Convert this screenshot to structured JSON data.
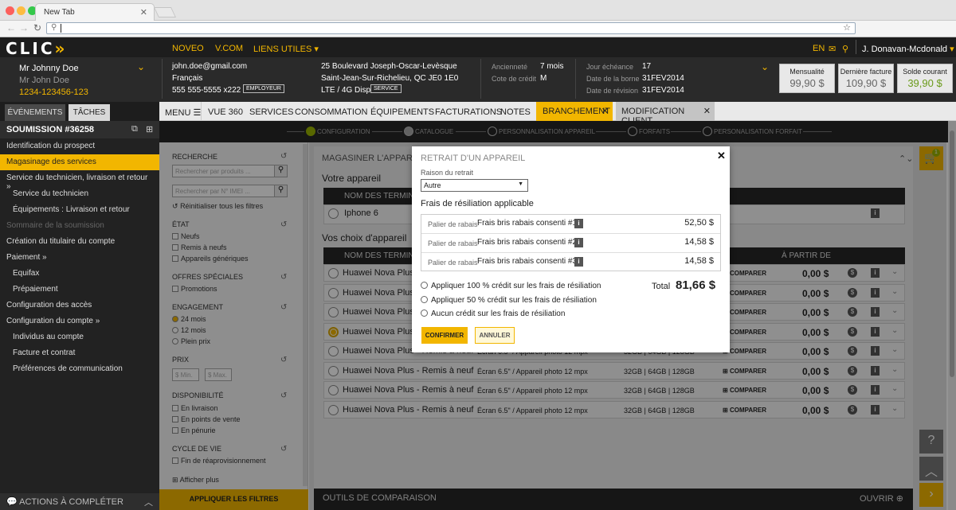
{
  "browser": {
    "tab_title": "New Tab"
  },
  "app": {
    "logo": "CLIC",
    "nav": [
      "NOVEO",
      "V.COM",
      "LIENS UTILES"
    ],
    "lang": "EN",
    "user": "J. Donavan-Mcdonald"
  },
  "customer": {
    "name": "Mr Johnny Doe",
    "name2": "Mr John Doe",
    "account": "1234-123456-123",
    "email": "john.doe@gmail.com",
    "language": "Français",
    "phone": "555 555-5555 x222",
    "phone_badge": "EMPLOYEUR",
    "address1": "25 Boulevard Joseph-Oscar-Levèsque",
    "address2": "Saint-Jean-Sur-Richelieu, QC JE0 1E0",
    "network": "LTE / 4G Disp",
    "network_badge": "SERVICE",
    "seniority_label": "Ancienneté",
    "seniority_value": "7 mois",
    "credit_label": "Cote de crédit",
    "credit_value": "M",
    "due_label": "Jour échéance",
    "due_value": "17",
    "kiosk_label": "Date de la borne",
    "kiosk_value": "31FEV2014",
    "revision_label": "Date de révision",
    "revision_value": "31FEV2014",
    "kpis": [
      {
        "label": "Mensualité",
        "value": "99,90 $"
      },
      {
        "label": "Dernière facture",
        "value": "109,90 $"
      },
      {
        "label": "Solde courant",
        "value": "39,90 $"
      }
    ]
  },
  "left_tabs": {
    "events": "ÉVÉNEMENTS",
    "tasks": "TÂCHES"
  },
  "menu": {
    "menu_label": "MENU",
    "items": [
      "VUE 360",
      "SERVICES",
      "CONSOMMATION",
      "ÉQUIPEMENTS",
      "FACTURATIONS",
      "NOTES"
    ],
    "active_tab": "BRANCHEMENT",
    "modify_tab": "MODIFICATION CLIENT"
  },
  "sidebar": {
    "submission": "SOUMISSION #36258",
    "items": [
      "Identification du prospect",
      "Magasinage des services",
      "Service du technicien, livraison et retour",
      "Service du technicien",
      "Équipements : Livraison et retour",
      "Sommaire de la soumission",
      "Création du titulaire du compte",
      "Paiement",
      "Equifax",
      "Prépaiement",
      "Configuration des accès",
      "Configuration du compte",
      "Individus au compte",
      "Facture et contrat",
      "Préférences de communication"
    ],
    "actions": "ACTIONS À COMPLÉTER"
  },
  "stepper": [
    "CONFIGURATION",
    "CATALOGUE",
    "PERSONNALISATION APPAREIL",
    "FORFAITS",
    "PERSONALISATION  FORFAIT"
  ],
  "filters": {
    "search_title": "RECHERCHE",
    "search_placeholder": "Rechercher par produits ...",
    "imei_placeholder": "Rechercher par N° IMEI ...",
    "reset": "Réinitialiser tous les filtres",
    "state_title": "ÉTAT",
    "state_options": [
      "Neufs",
      "Remis à neufs",
      "Appareils génériques"
    ],
    "special_title": "OFFRES SPÉCIALES",
    "special_options": [
      "Promotions"
    ],
    "engagement_title": "ENGAGEMENT",
    "engagement_options": [
      "24 mois",
      "12 mois",
      "Plein prix"
    ],
    "price_title": "PRIX",
    "price_min": "$ Min.",
    "price_max": "$ Max.",
    "dispo_title": "DISPONIBILITÉ",
    "dispo_options": [
      "En livraison",
      "En points de vente",
      "En pénurie"
    ],
    "cycle_title": "CYCLE DE VIE",
    "cycle_options": [
      "Fin de réaprovisionnement"
    ],
    "show_more": "Afficher plus",
    "apply": "APPLIQUER LES FILTRES"
  },
  "main": {
    "title": "MAGASINER L'APPAREIL",
    "your_device": "Votre appareil",
    "col_name": "NOM DES TERMINAUX",
    "current_device": "Iphone 6",
    "choices_title": "Vos choix d'appareil",
    "col_from": "À PARTIR DE",
    "compare": "COMPARER",
    "rows": [
      {
        "name": "Huawei Nova Plus - Remis à neuf",
        "screen": "Écran 6.5\" / Appareil photo 12 mpx",
        "storage": "32GB | 64GB | 128GB",
        "price": "0,00 $",
        "selected": false
      },
      {
        "name": "Huawei Nova Plus - Remis à neuf",
        "screen": "Écran 6.5\" / Appareil photo 12 mpx",
        "storage": "32GB | 64GB | 128GB",
        "price": "0,00 $",
        "selected": false
      },
      {
        "name": "Huawei Nova Plus - Remis à neuf",
        "screen": "Écran 6.5\" / Appareil photo 12 mpx",
        "storage": "32GB | 64GB | 128GB",
        "price": "0,00 $",
        "selected": false
      },
      {
        "name": "Huawei Nova Plus - Remis à neuf",
        "screen": "Écran 6.5\" / Appareil photo 12 mpx",
        "storage": "32GB | 64GB | 128GB",
        "price": "0,00 $",
        "selected": true
      },
      {
        "name": "Huawei Nova Plus - Remis à neuf",
        "screen": "Écran 6.5\" / Appareil photo 12 mpx",
        "storage": "32GB | 64GB | 128GB",
        "price": "0,00 $",
        "selected": false
      },
      {
        "name": "Huawei Nova Plus - Remis à neuf",
        "screen": "Écran 6.5\" / Appareil photo 12 mpx",
        "storage": "32GB | 64GB | 128GB",
        "price": "0,00 $",
        "selected": false
      },
      {
        "name": "Huawei Nova Plus - Remis à neuf",
        "screen": "Écran 6.5\" / Appareil photo 12 mpx",
        "storage": "32GB | 64GB | 128GB",
        "price": "0,00 $",
        "selected": false
      },
      {
        "name": "Huawei Nova Plus - Remis à neuf",
        "screen": "Écran 6.5\" / Appareil photo 12 mpx",
        "storage": "32GB | 64GB | 128GB",
        "price": "0,00 $",
        "selected": false
      }
    ],
    "compare_bar": "OUTILS DE COMPARAISON",
    "open": "OUVRIR"
  },
  "cart_count": "1",
  "modal": {
    "title": "RETRAIT D'UN APPAREIL",
    "reason_label": "Raison du retrait",
    "reason_value": "Autre",
    "fees_title": "Frais de résiliation applicable",
    "fees": [
      {
        "tier": "Palier de rabais",
        "name": "Frais bris rabais consenti #1",
        "amount": "52,50 $"
      },
      {
        "tier": "Palier de rabais",
        "name": "Frais bris rabais consenti #2",
        "amount": "14,58 $"
      },
      {
        "tier": "Palier de rabais",
        "name": "Frais bris rabais consenti #3",
        "amount": "14,58 $"
      }
    ],
    "options": [
      "Appliquer 100 % crédit sur les frais de résiliation",
      "Appliquer 50 % crédit sur les frais de résiliation",
      "Aucun crédit sur les frais de résiliation"
    ],
    "total_label": "Total",
    "total_value": "81,66 $",
    "confirm": "CONFIRMER",
    "cancel": "ANNULER"
  },
  "colors": {
    "accent": "#f2b600",
    "dark": "#222222"
  }
}
